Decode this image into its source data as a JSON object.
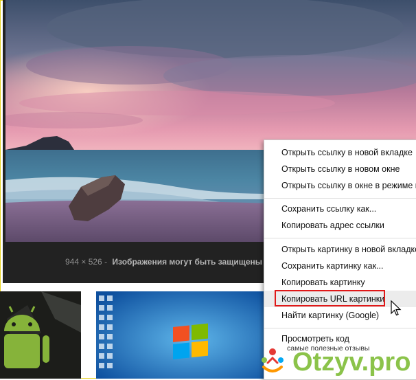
{
  "image_viewer": {
    "caption_dimensions": "944 × 526",
    "caption_separator": "-",
    "caption_notice": "Изображения могут быть защищены авт"
  },
  "context_menu": {
    "group1": [
      "Открыть ссылку в новой вкладке",
      "Открыть ссылку в новом окне",
      "Открыть ссылку в окне в режиме ин"
    ],
    "group2": [
      "Сохранить ссылку как...",
      "Копировать адрес ссылки"
    ],
    "group3": [
      "Открыть картинку в новой вкладке",
      "Сохранить картинку как...",
      "Копировать картинку",
      "Копировать URL картинки",
      "Найти картинку (Google)"
    ],
    "group4": [
      "Просмотреть код"
    ],
    "highlighted_item": "Копировать URL картинки",
    "highlight_color": "#e01818"
  },
  "watermark": {
    "tagline": "самые полезные отзывы",
    "brand": "Otzyv.pro",
    "brand_color": "#8bc34a"
  },
  "colors": {
    "frame": "#e8d21a",
    "panel_background": "#222222"
  }
}
